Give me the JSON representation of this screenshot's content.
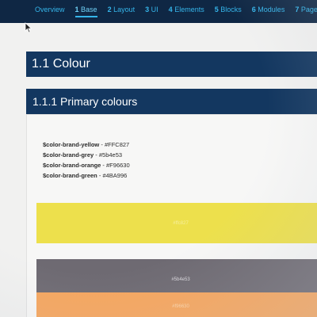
{
  "nav": {
    "tabs": [
      {
        "num": "",
        "label": "Overview"
      },
      {
        "num": "1",
        "label": "Base"
      },
      {
        "num": "2",
        "label": "Layout"
      },
      {
        "num": "3",
        "label": "UI"
      },
      {
        "num": "4",
        "label": "Elements"
      },
      {
        "num": "5",
        "label": "Blocks"
      },
      {
        "num": "6",
        "label": "Modules"
      },
      {
        "num": "7",
        "label": "Page"
      }
    ],
    "active_index": 1,
    "accent_color": "#35b5ea",
    "background_color": "#0f2744"
  },
  "section": {
    "title": "1.1 Colour",
    "subsection_title": "1.1.1 Primary colours"
  },
  "variables": [
    {
      "name": "$color-brand-yellow",
      "sep": " - ",
      "value": "#FFC827"
    },
    {
      "name": "$color-brand-grey",
      "sep": " - ",
      "value": "#5b4e53"
    },
    {
      "name": "$color-brand-orange",
      "sep": " - ",
      "value": "#F96630"
    },
    {
      "name": "$color-brand-green",
      "sep": " - ",
      "value": "#4BA996"
    }
  ],
  "swatches": [
    {
      "label": "#ffc827",
      "color": "#ede04c"
    },
    {
      "label": "#5b4e53",
      "color": "#6e6a72"
    },
    {
      "label": "#f96630",
      "color": "#f6a65e"
    }
  ]
}
